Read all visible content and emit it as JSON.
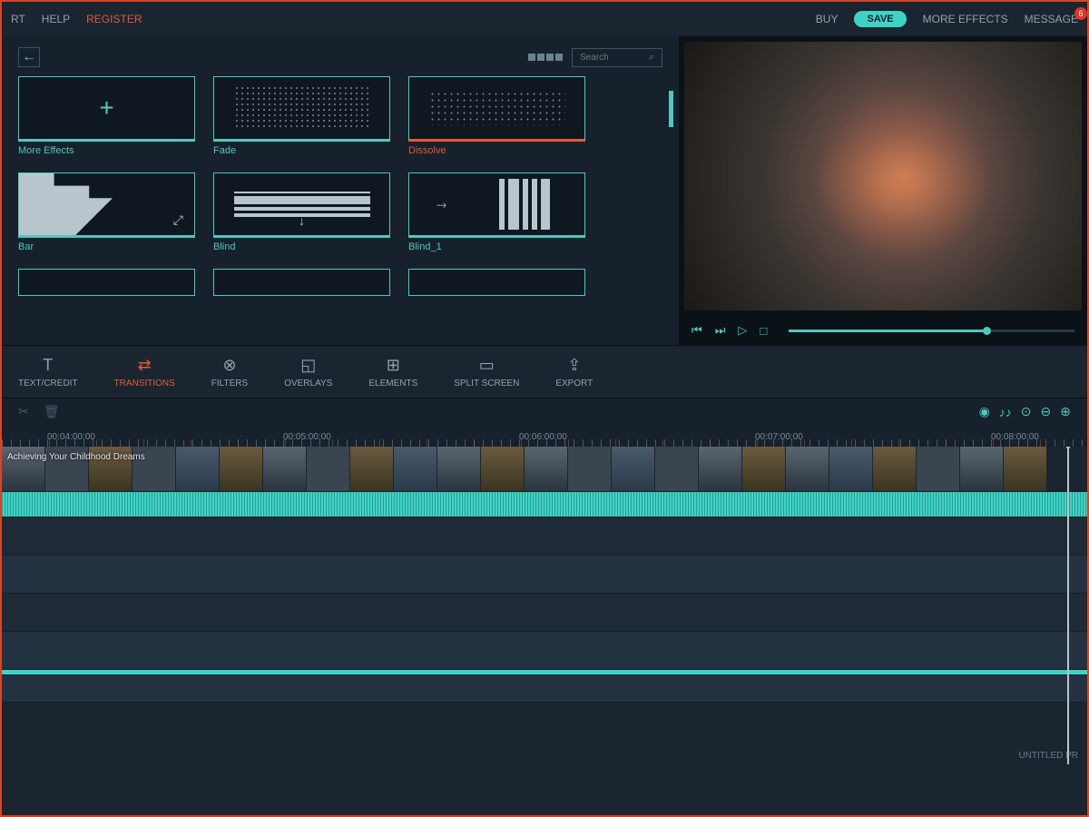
{
  "menu": {
    "rt": "RT",
    "help": "HELP",
    "register": "REGISTER"
  },
  "topright": {
    "buy": "BUY",
    "save": "SAVE",
    "more_effects": "MORE EFFECTS",
    "message": "MESSAGE",
    "badge": "6"
  },
  "search": {
    "placeholder": "Search"
  },
  "transitions": [
    {
      "label": "More Effects",
      "selected": false
    },
    {
      "label": "Fade",
      "selected": false
    },
    {
      "label": "Dissolve",
      "selected": true
    },
    {
      "label": "Bar",
      "selected": false
    },
    {
      "label": "Blind",
      "selected": false
    },
    {
      "label": "Blind_1",
      "selected": false
    }
  ],
  "tabs": [
    {
      "label": "TEXT/CREDIT"
    },
    {
      "label": "TRANSITIONS"
    },
    {
      "label": "FILTERS"
    },
    {
      "label": "OVERLAYS"
    },
    {
      "label": "ELEMENTS"
    },
    {
      "label": "SPLIT SCREEN"
    },
    {
      "label": "EXPORT"
    }
  ],
  "active_tab": "TRANSITIONS",
  "ruler": [
    "00:04:00:00",
    "00:05:00:00",
    "00:06:00:00",
    "00:07:00:00",
    "00:08:00:00"
  ],
  "clip_title": "Achieving Your Childhood Dreams",
  "footer": "UNTITLED PR"
}
